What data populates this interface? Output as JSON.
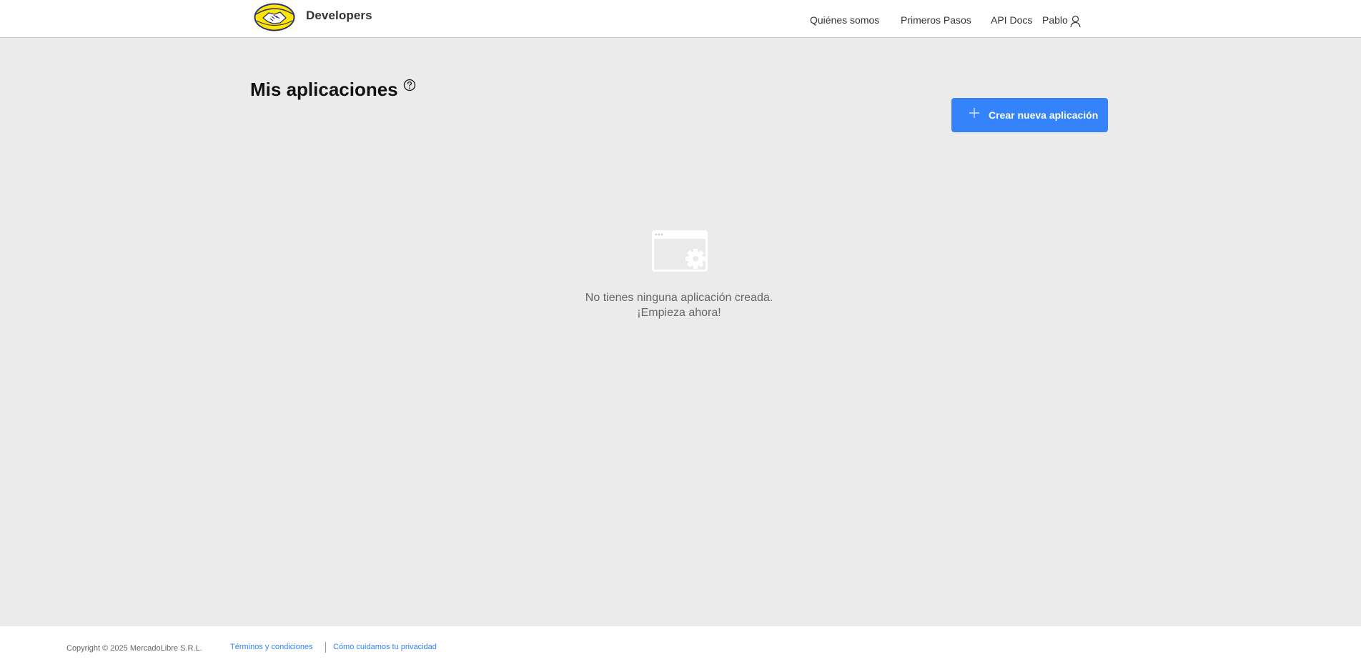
{
  "header": {
    "brand": "Developers",
    "logo_icon": "mercadolibre-handshake-logo",
    "nav": [
      "Quiénes somos",
      "Primeros Pasos",
      "API Docs"
    ],
    "user": {
      "name": "Pablo",
      "icon": "user-icon"
    }
  },
  "main": {
    "title": "Mis aplicaciones",
    "help_icon": "question-circle-icon",
    "create_button": {
      "label": "Crear nueva aplicación",
      "icon": "plus-icon"
    },
    "empty_state": {
      "icon": "app-window-gear-icon",
      "line1": "No tienes ninguna aplicación creada.",
      "line2": "¡Empieza ahora!"
    }
  },
  "footer": {
    "copyright": "Copyright © 2025 MercadoLibre S.R.L.",
    "links": [
      "Términos y condiciones",
      "Cómo cuidamos tu privacidad"
    ]
  },
  "colors": {
    "accent": "#3483fa",
    "brand_yellow": "#ffe600",
    "brand_navy": "#2d3277",
    "background": "#ebebeb"
  }
}
